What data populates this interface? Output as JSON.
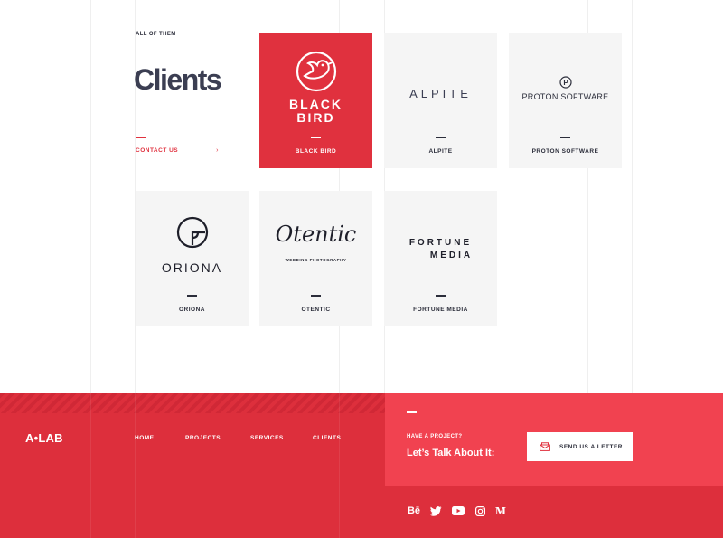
{
  "page": {
    "eyebrow": "ALL OF THEM",
    "title": "Clients",
    "contact_label": "CONTACT US",
    "contact_arrow": "›"
  },
  "clients": [
    {
      "name": "BLACK BIRD",
      "logo_text": [
        "BLACK",
        "BIRD"
      ],
      "logo_icon": "bird-icon",
      "highlight": true
    },
    {
      "name": "ALPITE",
      "logo_text": "ALPITE"
    },
    {
      "name": "PROTON SOFTWARE",
      "logo_text": "PROTON SOFTWARE",
      "logo_icon": "p-circle-icon"
    },
    {
      "name": "ORIONA",
      "logo_text": "ORIONA",
      "logo_icon": "oriona-mark-icon"
    },
    {
      "name": "OTENTIC",
      "logo_text": "Otentic",
      "logo_subtext": "WEDDING PHOTOGRAPHY"
    },
    {
      "name": "FORTUNE MEDIA",
      "logo_text": [
        "FORTUNE",
        "MEDIA"
      ]
    }
  ],
  "footer": {
    "brand": "A•LAB",
    "nav": [
      "HOME",
      "PROJECTS",
      "SERVICES",
      "CLIENTS"
    ],
    "cta_eyebrow": "HAVE A PROJECT?",
    "cta_title": "Let’s Talk About It:",
    "cta_button": "SEND US A LETTER",
    "cta_button_icon": "envelope-icon",
    "social": [
      {
        "icon": "behance-icon",
        "glyph": "Bē"
      },
      {
        "icon": "twitter-icon"
      },
      {
        "icon": "youtube-icon"
      },
      {
        "icon": "instagram-icon"
      },
      {
        "icon": "medium-icon",
        "glyph": "M"
      }
    ]
  },
  "colors": {
    "accent_red": "#e0313e",
    "footer_red": "#dd2f3c",
    "cta_red": "#f14250",
    "card_gray": "#f5f5f5",
    "text_dark": "#2b2d3a"
  }
}
